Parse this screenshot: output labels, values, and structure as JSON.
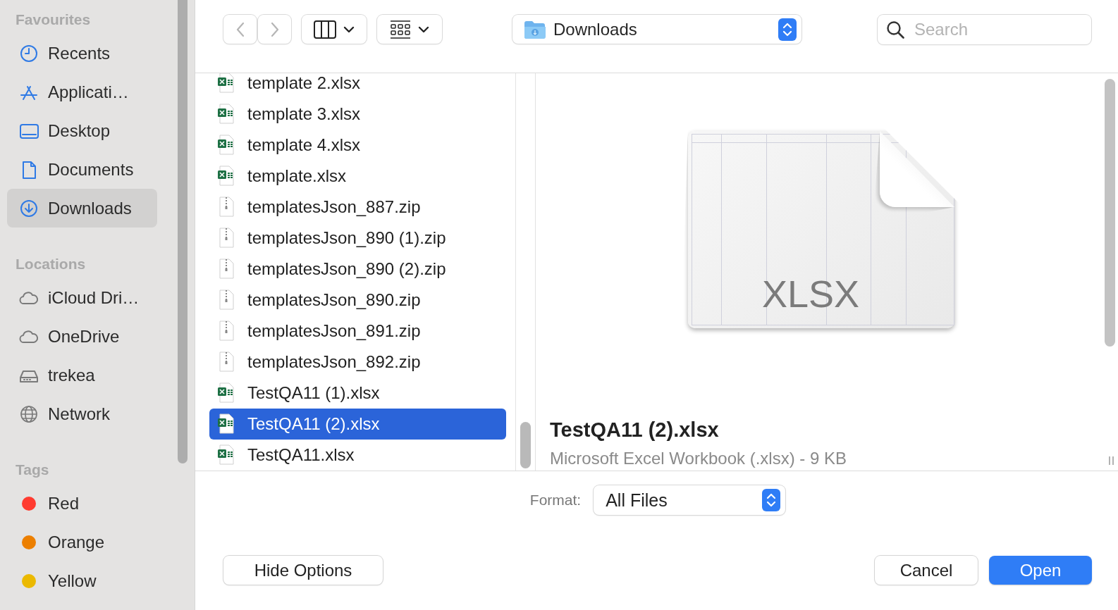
{
  "toolbar": {
    "location": "Downloads",
    "search": {
      "placeholder": "Search"
    }
  },
  "sidebar": {
    "sections": [
      {
        "title": "Favourites",
        "items": [
          {
            "label": "Recents",
            "kind": "recents",
            "selected": false
          },
          {
            "label": "Applicati…",
            "kind": "applications",
            "selected": false
          },
          {
            "label": "Desktop",
            "kind": "desktop",
            "selected": false
          },
          {
            "label": "Documents",
            "kind": "documents",
            "selected": false
          },
          {
            "label": "Downloads",
            "kind": "downloads",
            "selected": true
          }
        ]
      },
      {
        "title": "Locations",
        "items": [
          {
            "label": "iCloud Dri…",
            "kind": "cloud",
            "selected": false
          },
          {
            "label": "OneDrive",
            "kind": "cloud",
            "selected": false
          },
          {
            "label": "trekea",
            "kind": "drive",
            "selected": false
          },
          {
            "label": "Network",
            "kind": "network",
            "selected": false
          }
        ]
      },
      {
        "title": "Tags",
        "items": [
          {
            "label": "Red",
            "kind": "tag",
            "color": "#ff3b30",
            "selected": false
          },
          {
            "label": "Orange",
            "kind": "tag",
            "color": "#ec7f00",
            "selected": false
          },
          {
            "label": "Yellow",
            "kind": "tag",
            "color": "#ebb900",
            "selected": false
          }
        ]
      }
    ]
  },
  "files": [
    {
      "name": "template 2.xlsx",
      "kind": "xlsx",
      "selected": false
    },
    {
      "name": "template 3.xlsx",
      "kind": "xlsx",
      "selected": false
    },
    {
      "name": "template 4.xlsx",
      "kind": "xlsx",
      "selected": false
    },
    {
      "name": "template.xlsx",
      "kind": "xlsx",
      "selected": false
    },
    {
      "name": "templatesJson_887.zip",
      "kind": "zip",
      "selected": false
    },
    {
      "name": "templatesJson_890 (1).zip",
      "kind": "zip",
      "selected": false
    },
    {
      "name": "templatesJson_890 (2).zip",
      "kind": "zip",
      "selected": false
    },
    {
      "name": "templatesJson_890.zip",
      "kind": "zip",
      "selected": false
    },
    {
      "name": "templatesJson_891.zip",
      "kind": "zip",
      "selected": false
    },
    {
      "name": "templatesJson_892.zip",
      "kind": "zip",
      "selected": false
    },
    {
      "name": "TestQA11 (1).xlsx",
      "kind": "xlsx",
      "selected": false
    },
    {
      "name": "TestQA11 (2).xlsx",
      "kind": "xlsx",
      "selected": true
    },
    {
      "name": "TestQA11.xlsx",
      "kind": "xlsx",
      "selected": false
    }
  ],
  "preview": {
    "thumbnail": {
      "badge": "XLSX"
    },
    "name": "TestQA11 (2).xlsx",
    "info": "Microsoft Excel Workbook (.xlsx) - 9 KB"
  },
  "footer": {
    "format_label": "Format:",
    "format": "All Files",
    "buttons": [
      {
        "label": "Hide Options",
        "kind": "secondary"
      },
      {
        "label": "Cancel",
        "kind": "secondary"
      },
      {
        "label": "Open",
        "kind": "primary"
      }
    ]
  }
}
